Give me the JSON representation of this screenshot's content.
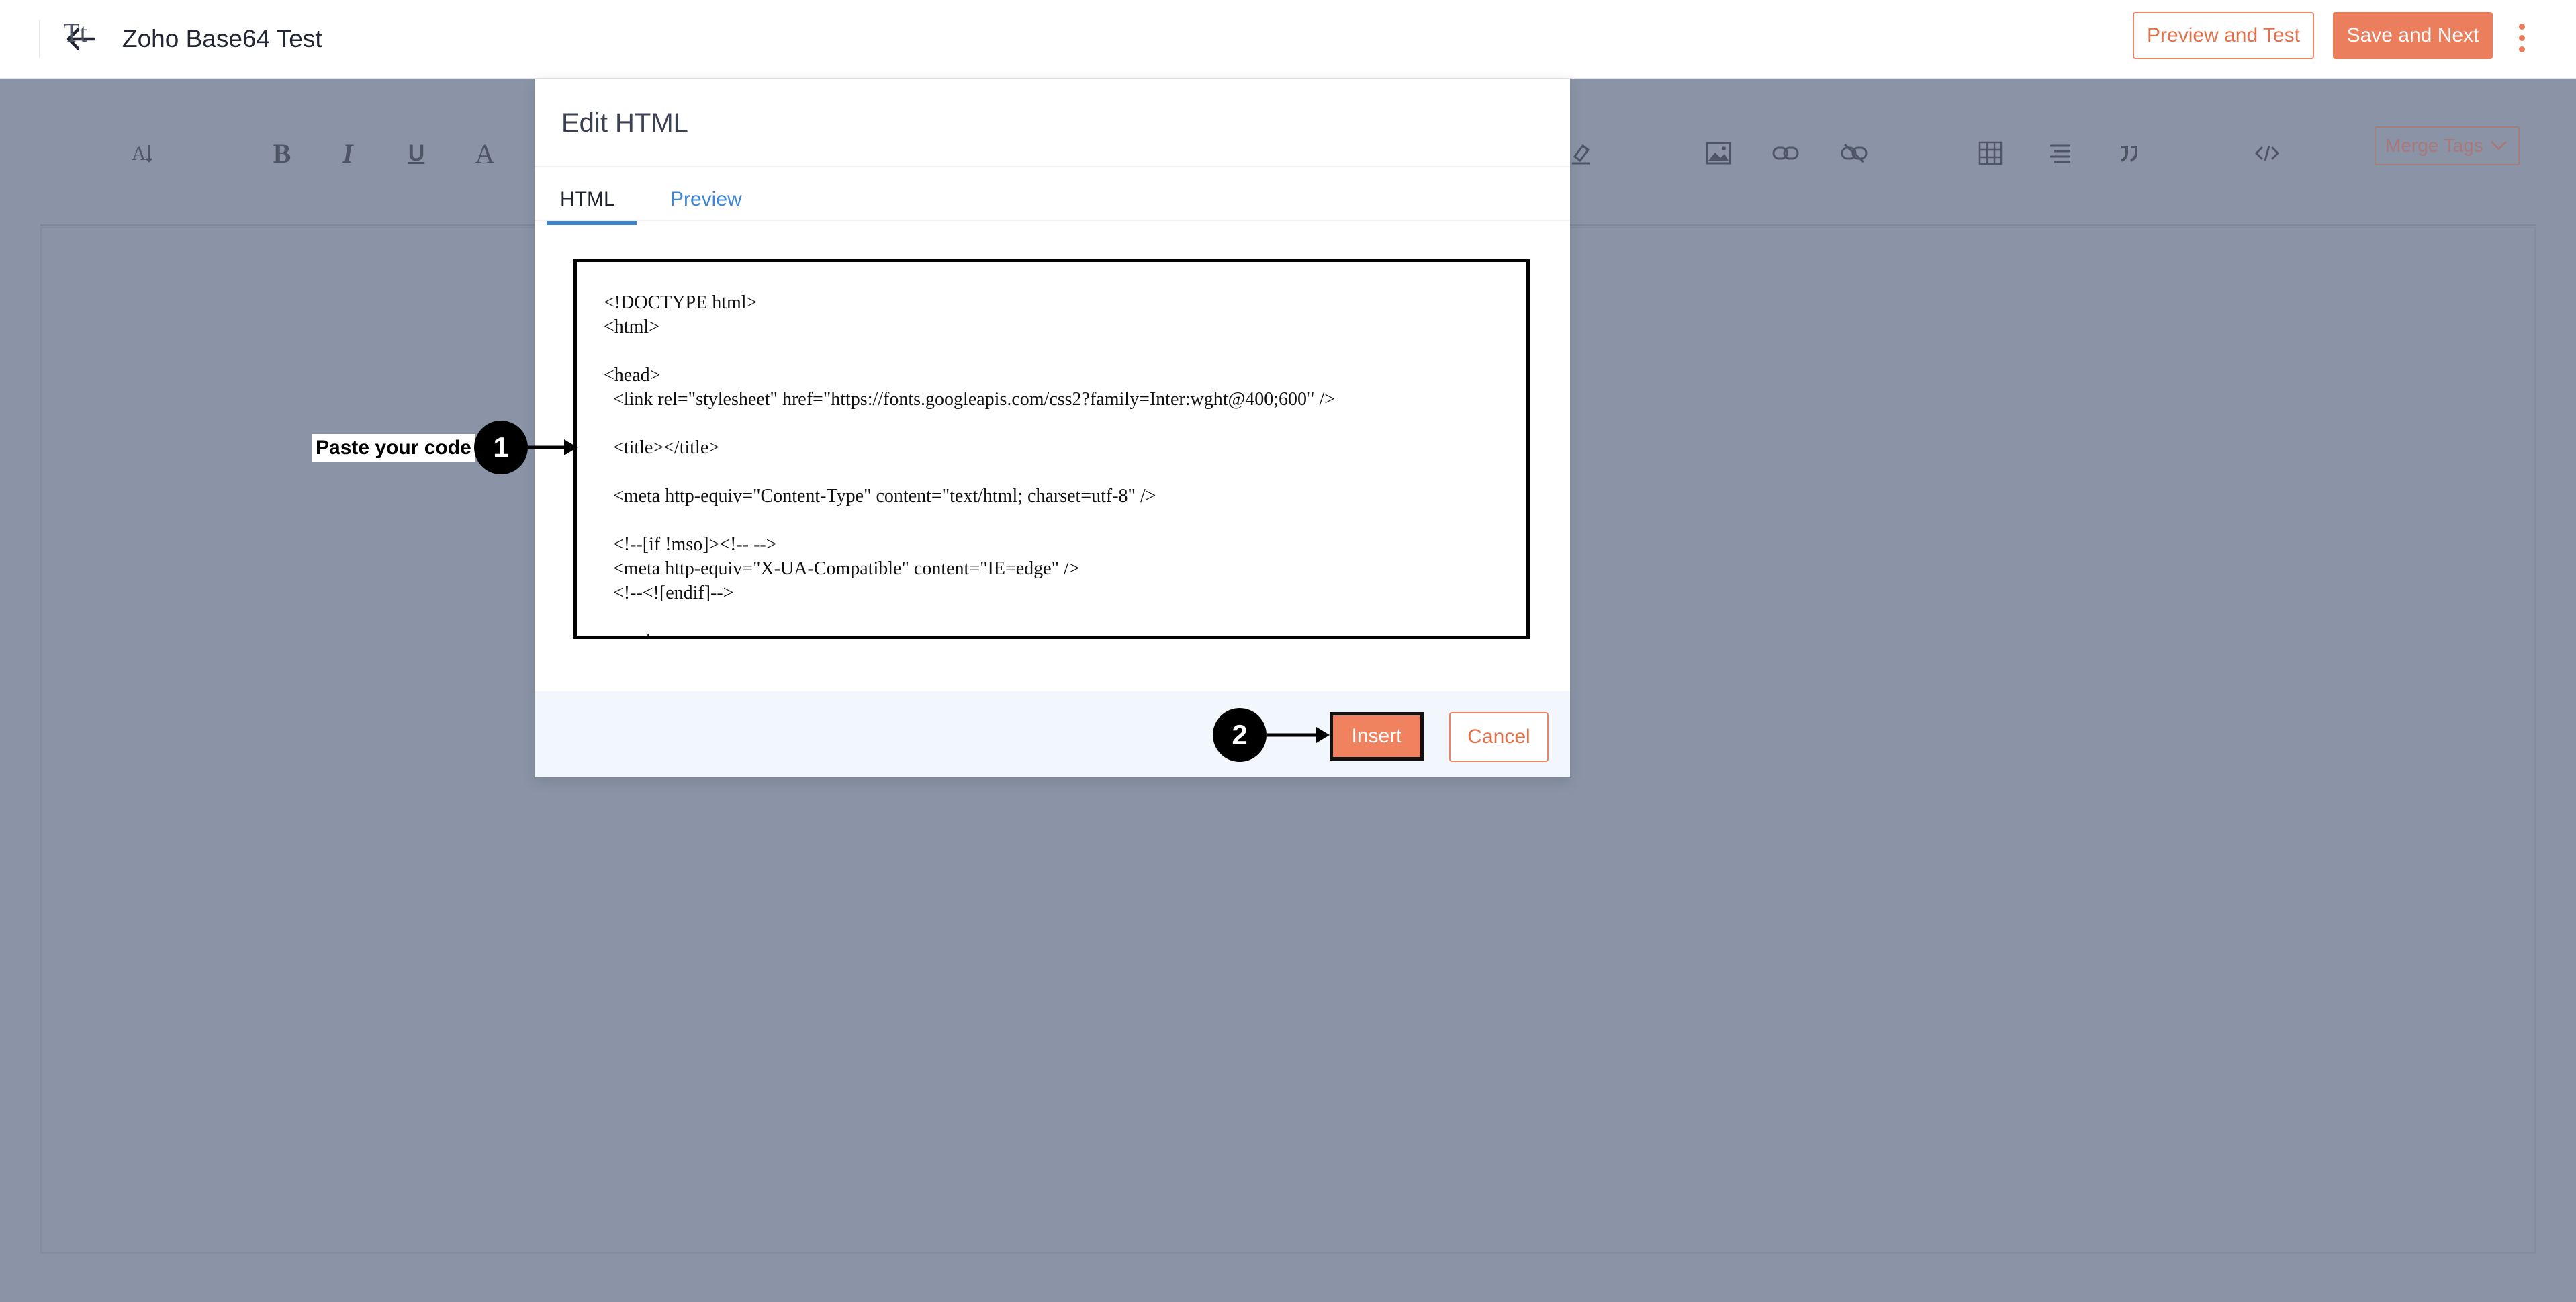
{
  "header": {
    "title": "Zoho Base64 Test",
    "preview_button": "Preview and Test",
    "save_button": "Save and Next"
  },
  "toolbar": {
    "merge_tags_label": "Merge Tags",
    "icons": [
      "text-size-icon",
      "font-family-icon",
      "bold-icon",
      "italic-icon",
      "underline-icon",
      "font-color-icon",
      "highlight-icon",
      "image-icon",
      "link-icon",
      "unlink-icon",
      "table-icon",
      "align-icon",
      "quote-icon",
      "code-view-icon",
      "chevron-down-icon"
    ]
  },
  "modal": {
    "title": "Edit HTML",
    "tabs": [
      {
        "label": "HTML",
        "active": true
      },
      {
        "label": "Preview",
        "active": false
      }
    ],
    "code_lines": [
      "<!DOCTYPE html>",
      "<html>",
      "",
      "<head>",
      "  <link rel=\"stylesheet\" href=\"https://fonts.googleapis.com/css2?family=Inter:wght@400;600\" />",
      "",
      "  <title></title>",
      "",
      "  <meta http-equiv=\"Content-Type\" content=\"text/html; charset=utf-8\" />",
      "",
      "  <!--[if !mso]><!-- -->",
      "  <meta http-equiv=\"X-UA-Compatible\" content=\"IE=edge\" />",
      "  <!--<![endif]-->",
      "",
      "  <style>"
    ],
    "insert_button": "Insert",
    "cancel_button": "Cancel"
  },
  "annotations": {
    "step1_label": "Paste your code",
    "step1_number": "1",
    "step2_number": "2"
  },
  "colors": {
    "accent": "#eb7f5d",
    "link_blue": "#3c86d4",
    "overlay": "#8b94a7"
  }
}
